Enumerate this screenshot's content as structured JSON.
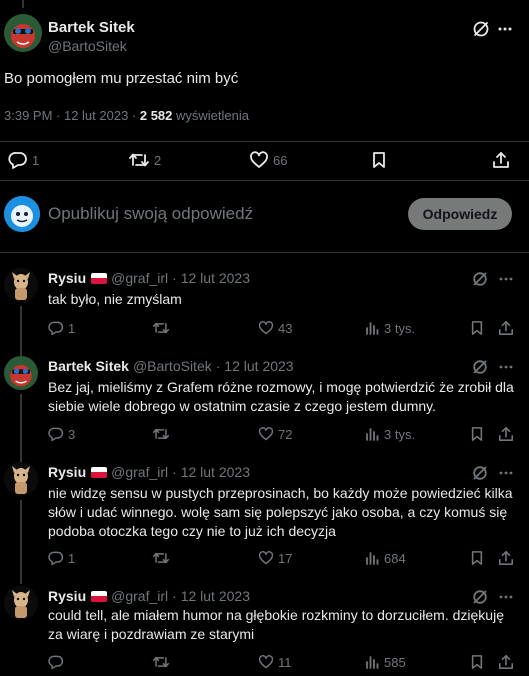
{
  "main_tweet": {
    "author_name": "Bartek Sitek",
    "author_handle": "@BartoSitek",
    "text": "Bo pomogłem mu przestać nim być",
    "time": "3:39 PM · 12 lut 2023 · ",
    "views_count": "2 582",
    "views_label": " wyświetlenia",
    "reply_count": "1",
    "retweet_count": "2",
    "like_count": "66"
  },
  "reply_box": {
    "placeholder": "Opublikuj swoją odpowiedź",
    "button_label": "Odpowiedz"
  },
  "colors": {
    "background": "#000000",
    "text": "#e7e9ea",
    "muted": "#71767b",
    "divider": "#2f3336",
    "button_bg": "#787a7a"
  },
  "replies": [
    {
      "name": "Rysiu",
      "handle": "@graf_irl",
      "date": "· 12 lut 2023",
      "text": "tak było, nie zmyślam",
      "reply_count": "1",
      "retweet_count": "",
      "like_count": "43",
      "views": "3 tys."
    },
    {
      "name": "Bartek Sitek",
      "handle": "@BartoSitek",
      "date": "· 12 lut 2023",
      "text": "Bez jaj, mieliśmy z Grafem różne rozmowy, i mogę potwierdzić że zrobił dla siebie wiele dobrego w ostatnim czasie z czego jestem dumny.",
      "reply_count": "3",
      "retweet_count": "",
      "like_count": "72",
      "views": "3 tys."
    },
    {
      "name": "Rysiu",
      "handle": "@graf_irl",
      "date": "· 12 lut 2023",
      "text": "nie widzę sensu w pustych przeprosinach, bo każdy może powiedzieć kilka słów i udać winnego. wolę sam się polepszyć jako osoba, a czy komuś się podoba otoczka tego czy nie to już ich decyzja",
      "reply_count": "1",
      "retweet_count": "",
      "like_count": "17",
      "views": "684"
    },
    {
      "name": "Rysiu",
      "handle": "@graf_irl",
      "date": "· 12 lut 2023",
      "text": "could tell, ale miałem humor na głębokie rozkminy to dorzuciłem. dziękuję za wiarę i pozdrawiam ze starymi",
      "reply_count": "",
      "retweet_count": "",
      "like_count": "11",
      "views": "585"
    }
  ]
}
